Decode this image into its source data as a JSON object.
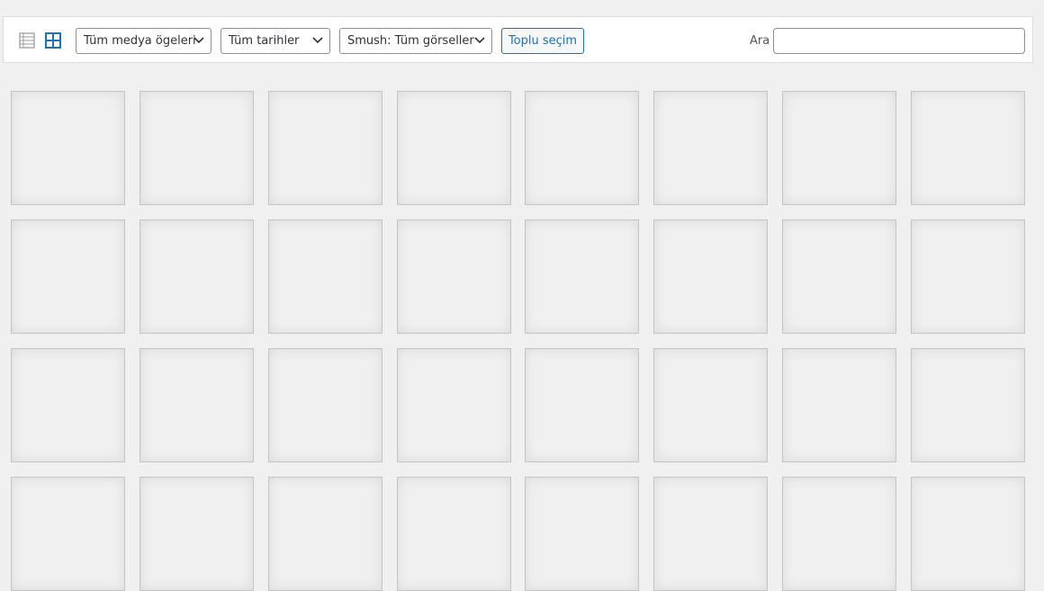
{
  "toolbar": {
    "view_list_icon": "list-view-icon",
    "view_grid_icon": "grid-view-icon",
    "active_view": "grid",
    "filters": {
      "type_selected": "Tüm medya ögeleri",
      "date_selected": "Tüm tarihler",
      "smush_selected": "Smush: Tüm görseller"
    },
    "bulk_select_label": "Toplu seçim",
    "search": {
      "label": "Ara",
      "value": ""
    }
  },
  "colors": {
    "accent": "#2271b1",
    "inactive_icon": "#a7aaad",
    "background": "#f0f0f1"
  },
  "media_grid": {
    "columns": 8,
    "visible_rows": 4,
    "tile_state": "loading-placeholder"
  }
}
